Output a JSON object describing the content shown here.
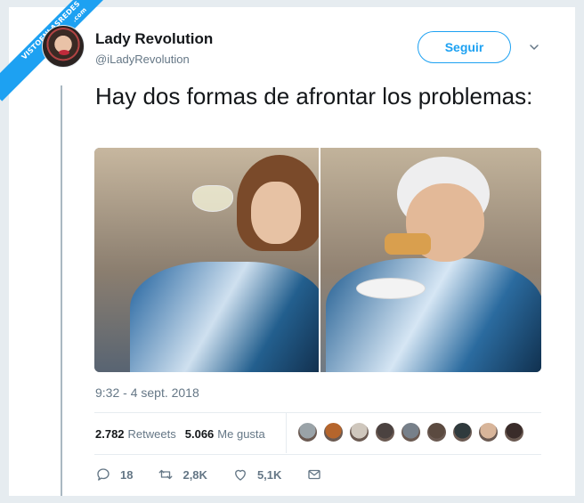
{
  "watermark": {
    "line1": "VISTOENLASREDES",
    "line2": ".com"
  },
  "author": {
    "name": "Lady Revolution",
    "handle": "@iLadyRevolution"
  },
  "follow_label": "Seguir",
  "tweet": {
    "text": "Hay dos formas de afrontar los problemas:",
    "timestamp": "9:32 - 4 sept. 2018"
  },
  "stats": {
    "retweets_count": "2.782",
    "retweets_label": "Retweets",
    "likes_count": "5.066",
    "likes_label": "Me gusta"
  },
  "liker_colors": [
    "#9aa3a8",
    "#b5652c",
    "#cfc7bd",
    "#4b4240",
    "#77808a",
    "#5b4a40",
    "#2f3a3d",
    "#d8b59a",
    "#3a2c2a"
  ],
  "actions": {
    "reply_count": "18",
    "retweet_count": "2,8K",
    "like_count": "5,1K"
  },
  "accent_color": "#1da1f2"
}
